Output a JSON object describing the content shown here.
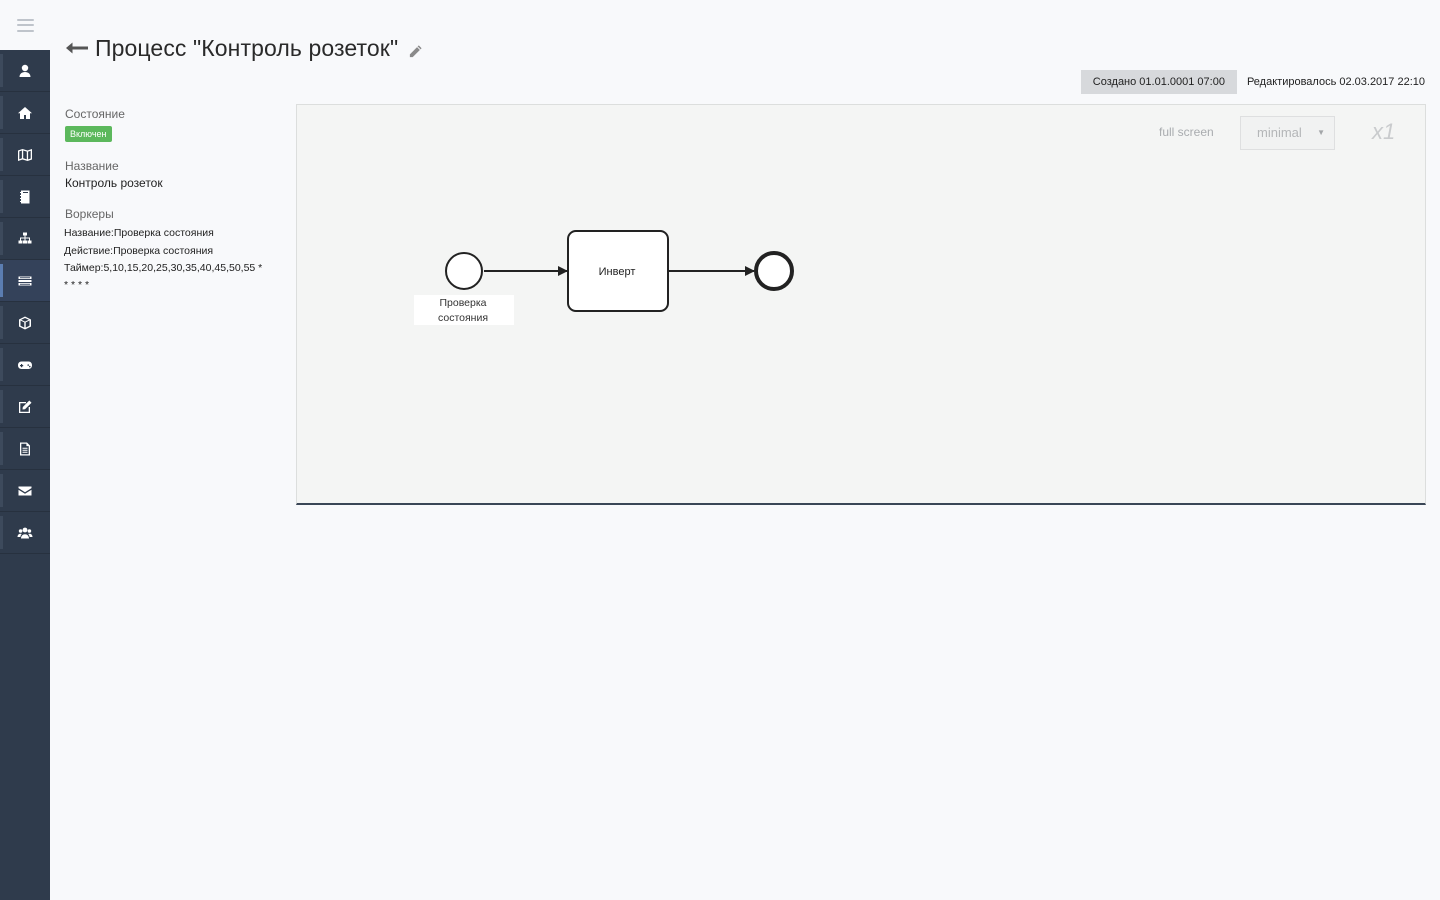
{
  "header": {
    "title": "Процесс \"Контроль розеток\"",
    "created": "Создано 01.01.0001 07:00",
    "edited": "Редактировалось 02.03.2017 22:10"
  },
  "sidebar": {
    "items": [
      {
        "icon": "user-icon"
      },
      {
        "icon": "home-icon"
      },
      {
        "icon": "map-icon"
      },
      {
        "icon": "notebook-icon"
      },
      {
        "icon": "sitemap-icon"
      },
      {
        "icon": "tasks-icon",
        "active": true
      },
      {
        "icon": "cube-icon"
      },
      {
        "icon": "gamepad-icon"
      },
      {
        "icon": "edit-icon"
      },
      {
        "icon": "document-icon"
      },
      {
        "icon": "envelope-icon"
      },
      {
        "icon": "users-icon"
      }
    ]
  },
  "info": {
    "state_label": "Состояние",
    "state_value": "Включен",
    "name_label": "Название",
    "name_value": "Контроль розеток",
    "workers_label": "Воркеры",
    "workers": [
      "Название:Проверка состояния",
      "Действие:Проверка состояния",
      "Таймер:5,10,15,20,25,30,35,40,45,50,55 * * * * *"
    ]
  },
  "canvas": {
    "fullscreen_label": "full screen",
    "view_mode": "minimal",
    "zoom": "x1",
    "start_event_label_line1": "Проверка",
    "start_event_label_line2": "состояния",
    "task_label": "Инверт"
  },
  "colors": {
    "sidebar_bg": "#2f3b4c",
    "status_green": "#5cb85c",
    "canvas_bg": "#f4f5f4"
  }
}
